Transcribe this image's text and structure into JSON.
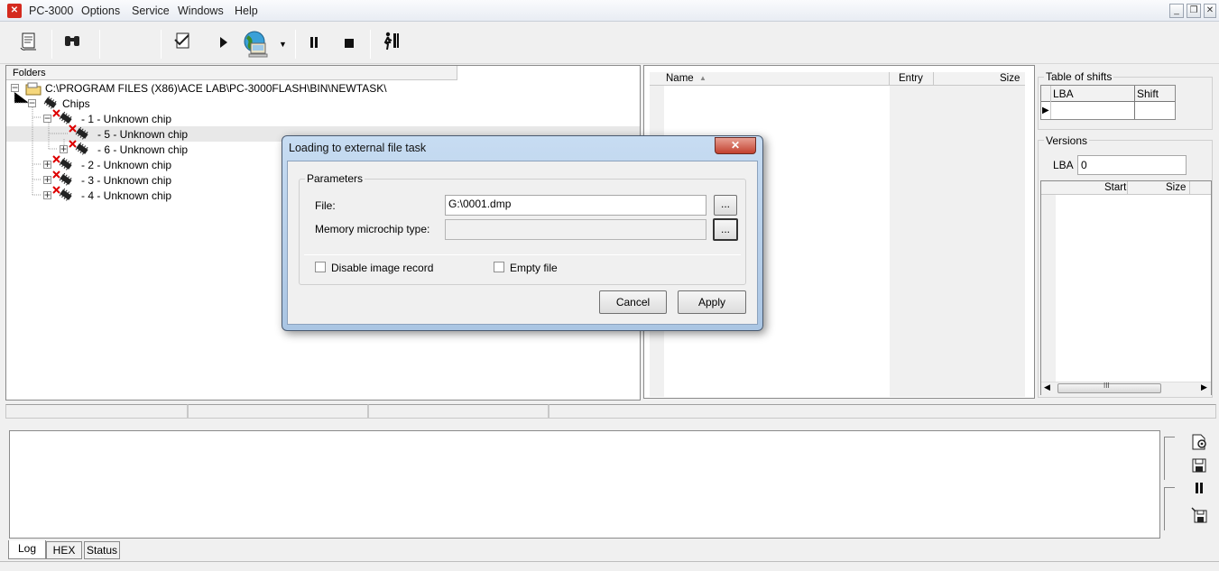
{
  "app": {
    "title": "PC-3000",
    "icon": "pc3000-logo-icon"
  },
  "menu": [
    "Options",
    "Service",
    "Windows",
    "Help"
  ],
  "window_controls": {
    "minimize": "_",
    "restore": "❐",
    "close": "✕"
  },
  "toolbar": {
    "icons": [
      "scroll-icon",
      "binoculars-icon",
      "document-check-icon",
      "play-icon",
      "network-globe-icon",
      "dropdown-arrow-icon",
      "pause-icon",
      "stop-icon",
      "exit-icon"
    ]
  },
  "folders": {
    "header": "Folders",
    "root": "C:\\PROGRAM FILES (X86)\\ACE LAB\\PC-3000FLASH\\BIN\\NEWTASK\\",
    "chips_label": "Chips",
    "items": [
      "- 1 - Unknown chip",
      "- 5 - Unknown chip",
      "- 6 - Unknown chip",
      "- 2 - Unknown chip",
      "- 3 - Unknown chip",
      "- 4 - Unknown chip"
    ]
  },
  "file_list": {
    "columns": [
      "Name",
      "Entry",
      "Size"
    ]
  },
  "shifts": {
    "title": "Table of shifts",
    "columns": [
      "LBA",
      "Shift"
    ]
  },
  "versions": {
    "title": "Versions",
    "lba_label": "LBA",
    "lba_value": "0",
    "columns": [
      "Start",
      "Size"
    ],
    "scroll_mid": "III"
  },
  "bottom_tabs": [
    "Log",
    "HEX",
    "Status"
  ],
  "dialog": {
    "title": "Loading to external file task",
    "close": "✕",
    "group": "Parameters",
    "file_label": "File:",
    "file_value": "G:\\0001.dmp",
    "browse": "...",
    "memory_label": "Memory microchip type:",
    "memory_value": "",
    "disable_label": "Disable image record",
    "empty_label": "Empty file",
    "cancel": "Cancel",
    "apply": "Apply"
  }
}
